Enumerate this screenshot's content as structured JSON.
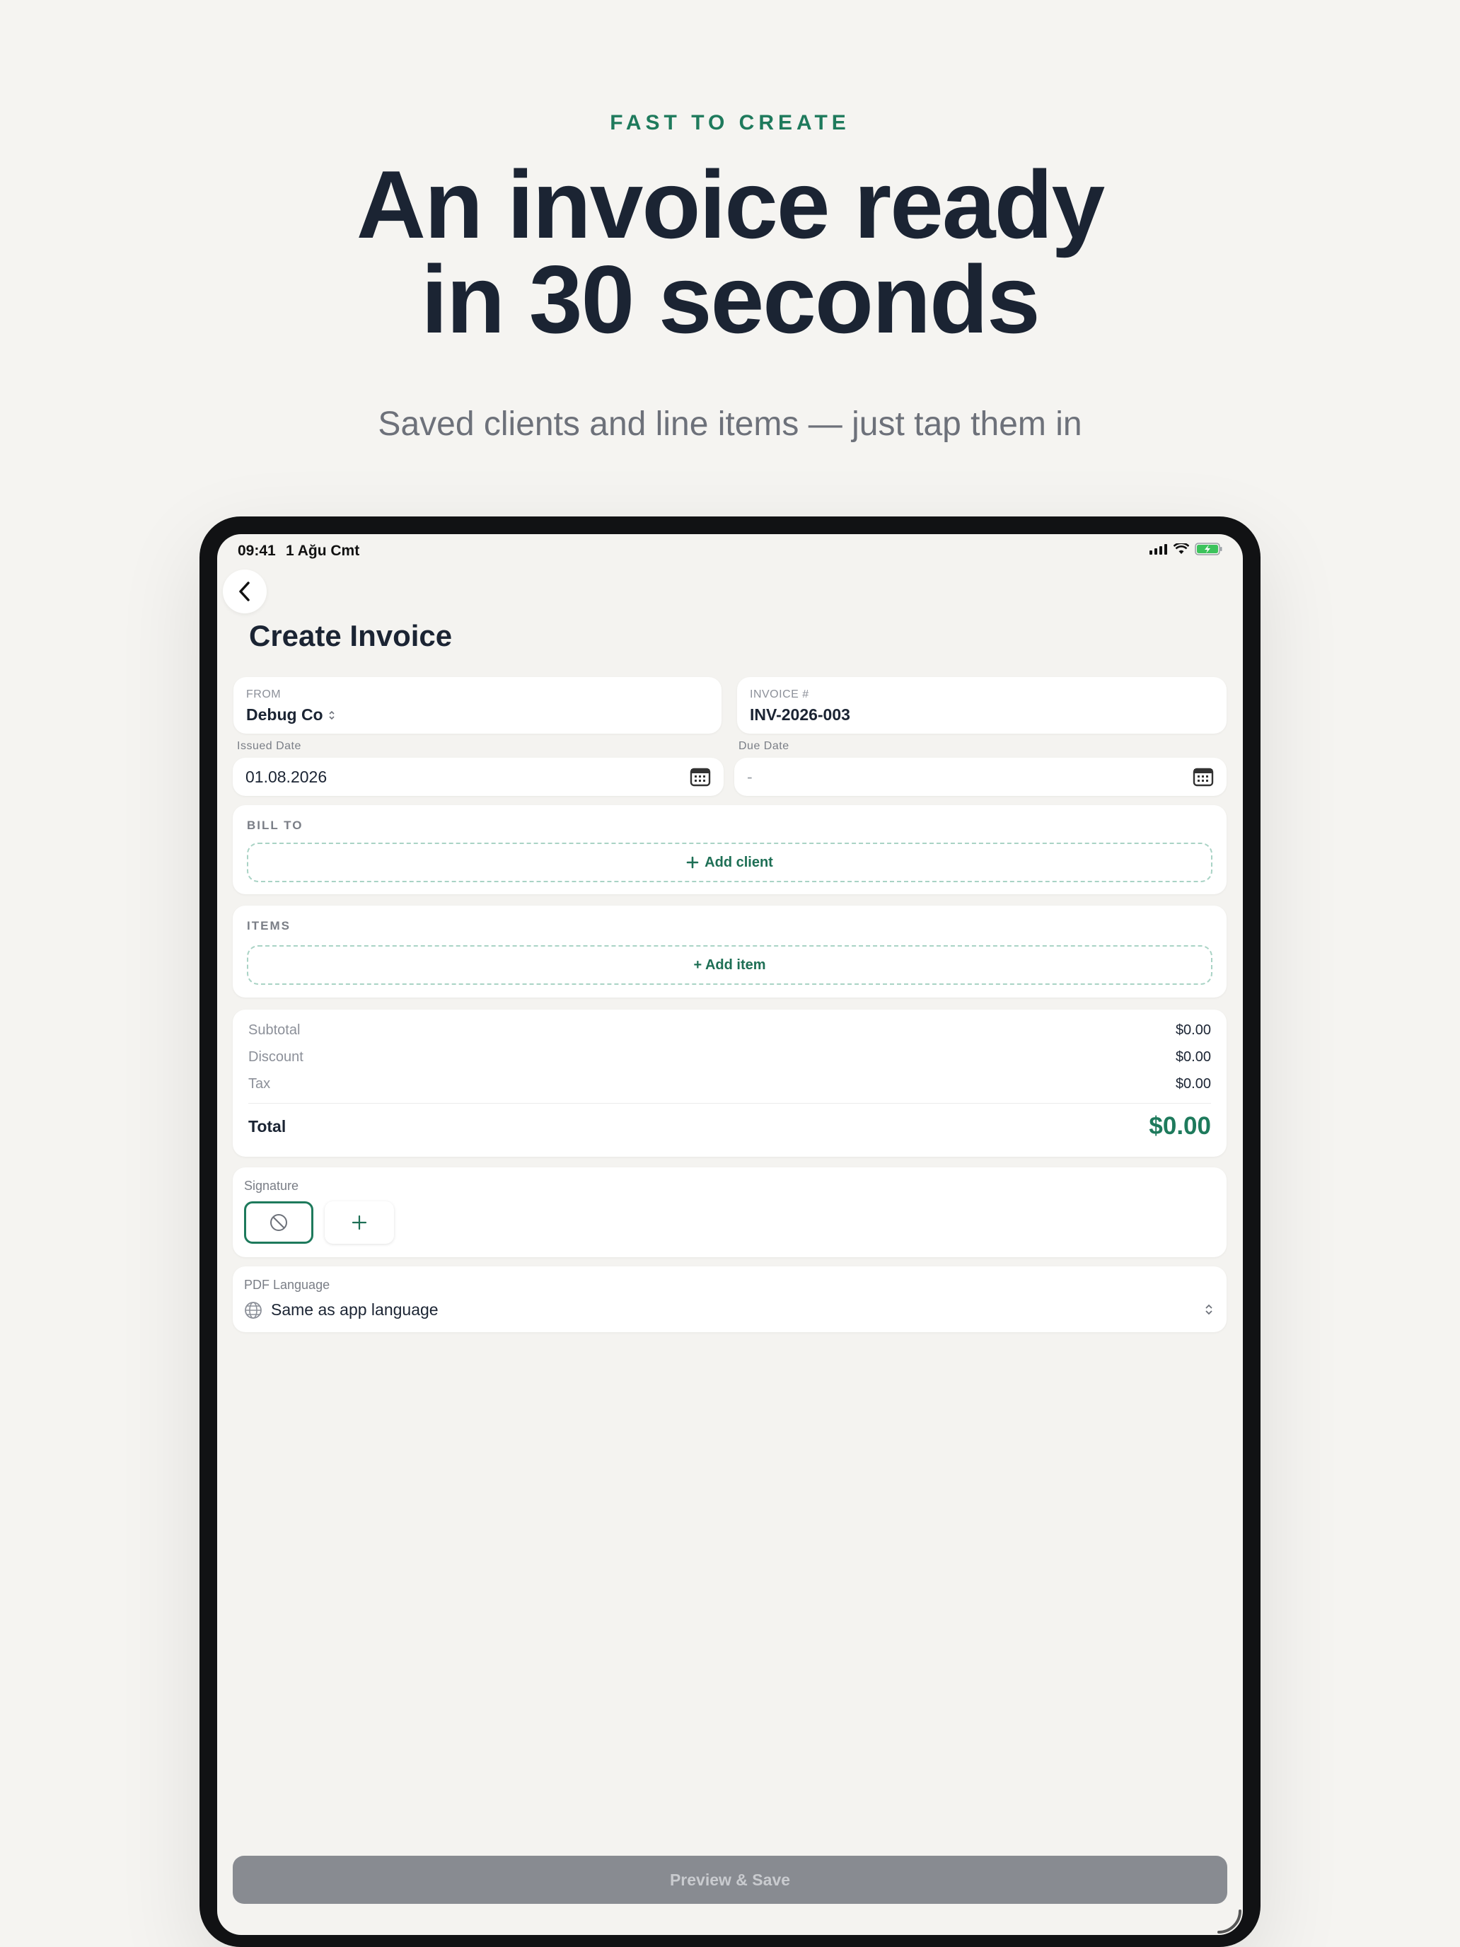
{
  "hero": {
    "eyebrow": "FAST TO CREATE",
    "headline_line1": "An invoice ready",
    "headline_line2": "in 30 seconds",
    "subhead": "Saved clients and line items — just tap them in"
  },
  "status_bar": {
    "time": "09:41",
    "date": "1 Ağu Cmt"
  },
  "page": {
    "title": "Create Invoice"
  },
  "from": {
    "label": "FROM",
    "value": "Debug Co"
  },
  "invoice_number": {
    "label": "INVOICE #",
    "value": "INV-2026-003"
  },
  "issued_date": {
    "label": "Issued Date",
    "value": "01.08.2026"
  },
  "due_date": {
    "label": "Due Date",
    "value": "-"
  },
  "bill_to": {
    "label": "BILL TO",
    "add_label": "Add client"
  },
  "items": {
    "label": "ITEMS",
    "add_label": "+ Add item"
  },
  "summary": {
    "subtotal_label": "Subtotal",
    "subtotal_value": "$0.00",
    "discount_label": "Discount",
    "discount_value": "$0.00",
    "tax_label": "Tax",
    "tax_value": "$0.00",
    "total_label": "Total",
    "total_value": "$0.00"
  },
  "signature": {
    "label": "Signature"
  },
  "pdf_language": {
    "label": "PDF Language",
    "value": "Same as app language"
  },
  "actions": {
    "preview_save": "Preview & Save"
  },
  "colors": {
    "accent": "#1e7a5c",
    "headline": "#1b2433",
    "disabled_button": "#888b91"
  }
}
